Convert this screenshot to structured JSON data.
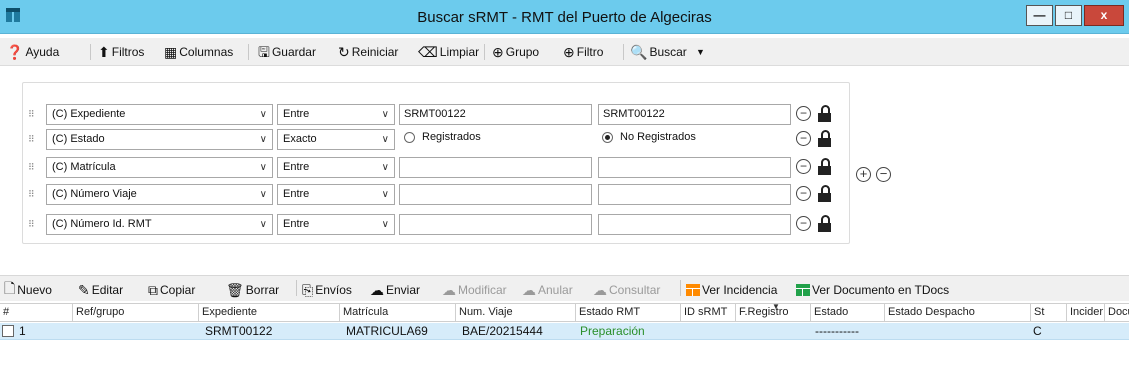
{
  "window": {
    "title": "Buscar sRMT - RMT del Puerto de Algeciras",
    "buttons": {
      "minimize": "—",
      "maximize": "□",
      "close": "x"
    }
  },
  "toolbar": {
    "help": "Ayuda",
    "filters": "Filtros",
    "columns": "Columnas",
    "save": "Guardar",
    "restart": "Reiniciar",
    "clear": "Limpiar",
    "group": "Grupo",
    "filter": "Filtro",
    "search": "Buscar",
    "menu_arrow": "▼"
  },
  "filters": [
    {
      "field": "(C) Expediente",
      "operator": "Entre",
      "value_from": "SRMT00122",
      "value_to": "SRMT00122",
      "type": "range"
    },
    {
      "field": "(C) Estado",
      "operator": "Exacto",
      "type": "radio",
      "options": [
        {
          "label": "Registrados",
          "selected": false
        },
        {
          "label": "No Registrados",
          "selected": true
        }
      ]
    },
    {
      "field": "(C) Matrícula",
      "operator": "Entre",
      "value_from": "",
      "value_to": "",
      "type": "range"
    },
    {
      "field": "(C) Número Viaje",
      "operator": "Entre",
      "value_from": "",
      "value_to": "",
      "type": "range"
    },
    {
      "field": "(C) Número Id. RMT",
      "operator": "Entre",
      "value_from": "",
      "value_to": "",
      "type": "range"
    }
  ],
  "actions": {
    "new": "Nuevo",
    "edit": "Editar",
    "copy": "Copiar",
    "delete": "Borrar",
    "shipments": "Envíos",
    "send": "Enviar",
    "modify": "Modificar",
    "cancel": "Anular",
    "query": "Consultar",
    "view_incident": "Ver Incidencia",
    "view_document": "Ver Documento en TDocs"
  },
  "grid": {
    "columns": [
      "#",
      "Ref/grupo",
      "Expediente",
      "Matrícula",
      "Num. Viaje",
      "Estado RMT",
      "ID sRMT",
      "F.Registro",
      "Estado",
      "Estado Despacho",
      "St",
      "Incider",
      "Docu"
    ],
    "rows": [
      {
        "num": "1",
        "ref": "",
        "expediente": "SRMT00122",
        "matricula": "MATRICULA69",
        "viaje": "BAE/20215444",
        "estado_rmt": "Preparación",
        "id_srmt": "",
        "f_registro": "",
        "estado": "-----------",
        "despacho": "",
        "st": "C"
      }
    ]
  },
  "colors": {
    "titlebar": "#6ccbed",
    "selected_row": "#d6ecfa",
    "status_green": "#2a8f2a"
  }
}
